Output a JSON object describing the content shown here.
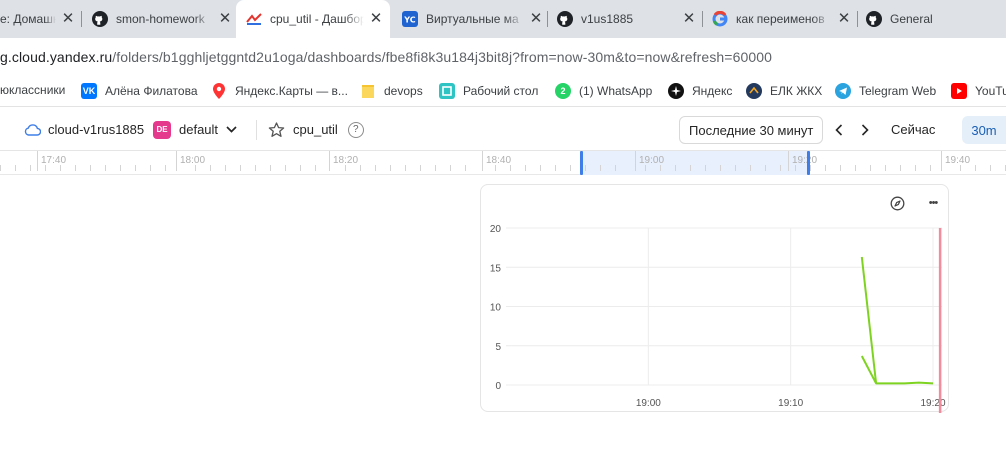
{
  "tabs": [
    {
      "title": "e: Домашн",
      "icon": "doc-icon"
    },
    {
      "title": "smon-homework",
      "icon": "github-icon"
    },
    {
      "title": "cpu_util - Дашборд",
      "icon": "monitoring-icon"
    },
    {
      "title": "Виртуальные ма",
      "icon": "yandex-cloud-icon"
    },
    {
      "title": "v1us1885",
      "icon": "github-icon"
    },
    {
      "title": "как переименов",
      "icon": "google-icon"
    },
    {
      "title": "General",
      "icon": "github-icon"
    }
  ],
  "tab_close_glyph": "✕",
  "address": {
    "host": "g.cloud.yandex.ru",
    "path": "/folders/b1gghljetggntd2u1oga/dashboards/fbe8fi8k3u184j3bit8j?from=now-30m&to=now&refresh=60000"
  },
  "bookmarks": [
    {
      "label": "юклассники",
      "icon": "ok-icon"
    },
    {
      "label": "Алёна Филатова",
      "icon": "vk-icon"
    },
    {
      "label": "Яндекс.Карты — в...",
      "icon": "map-pin-icon"
    },
    {
      "label": "devops",
      "icon": "folder-icon"
    },
    {
      "label": "Рабочий стол",
      "icon": "desktop-icon"
    },
    {
      "label": "(1) WhatsApp",
      "icon": "whatsapp-icon"
    },
    {
      "label": "Яндекс",
      "icon": "yandex-icon"
    },
    {
      "label": "ЕЛК ЖКХ",
      "icon": "elk-icon"
    },
    {
      "label": "Telegram Web",
      "icon": "telegram-icon"
    },
    {
      "label": "YouTu",
      "icon": "youtube-icon"
    }
  ],
  "header": {
    "cloud": "cloud-v1rus1885",
    "folder_badge": "DE",
    "folder": "default",
    "dashboard": "cpu_util",
    "help": "?",
    "range_button": "Последние 30 минут",
    "now_button": "Сейчас",
    "refresh_button": "30m"
  },
  "ruler_ticks": [
    "17:40",
    "18:00",
    "18:20",
    "18:40",
    "19:00",
    "19:20",
    "19:40"
  ],
  "panel": {
    "more_glyph": "•••"
  },
  "chart_data": {
    "type": "line",
    "x_ticks": [
      "19:00",
      "19:10",
      "19:20"
    ],
    "y_ticks": [
      "0",
      "5",
      "10",
      "15",
      "20"
    ],
    "ylim": [
      0,
      20
    ],
    "xlim_minutes": [
      "18:50",
      "19:20"
    ],
    "grid": true,
    "series": [
      {
        "color": "#7ed321",
        "points": [
          {
            "x": "19:15",
            "y": 16.3
          },
          {
            "x": "19:16",
            "y": 0.2
          },
          {
            "x": "19:18",
            "y": 0.2
          },
          {
            "x": "19:19",
            "y": 0.3
          },
          {
            "x": "19:20",
            "y": 0.2
          }
        ]
      },
      {
        "color": "#7ed321",
        "points": [
          {
            "x": "19:15",
            "y": 3.7
          },
          {
            "x": "19:16",
            "y": 0.2
          }
        ]
      }
    ],
    "now_marker": {
      "x": "19:20.5",
      "color": "#f28b9b"
    }
  },
  "colors": {
    "accent": "#3f7ee8",
    "series": "#7ed321",
    "now_line": "#f28b9b",
    "badge": "#e5398e"
  }
}
